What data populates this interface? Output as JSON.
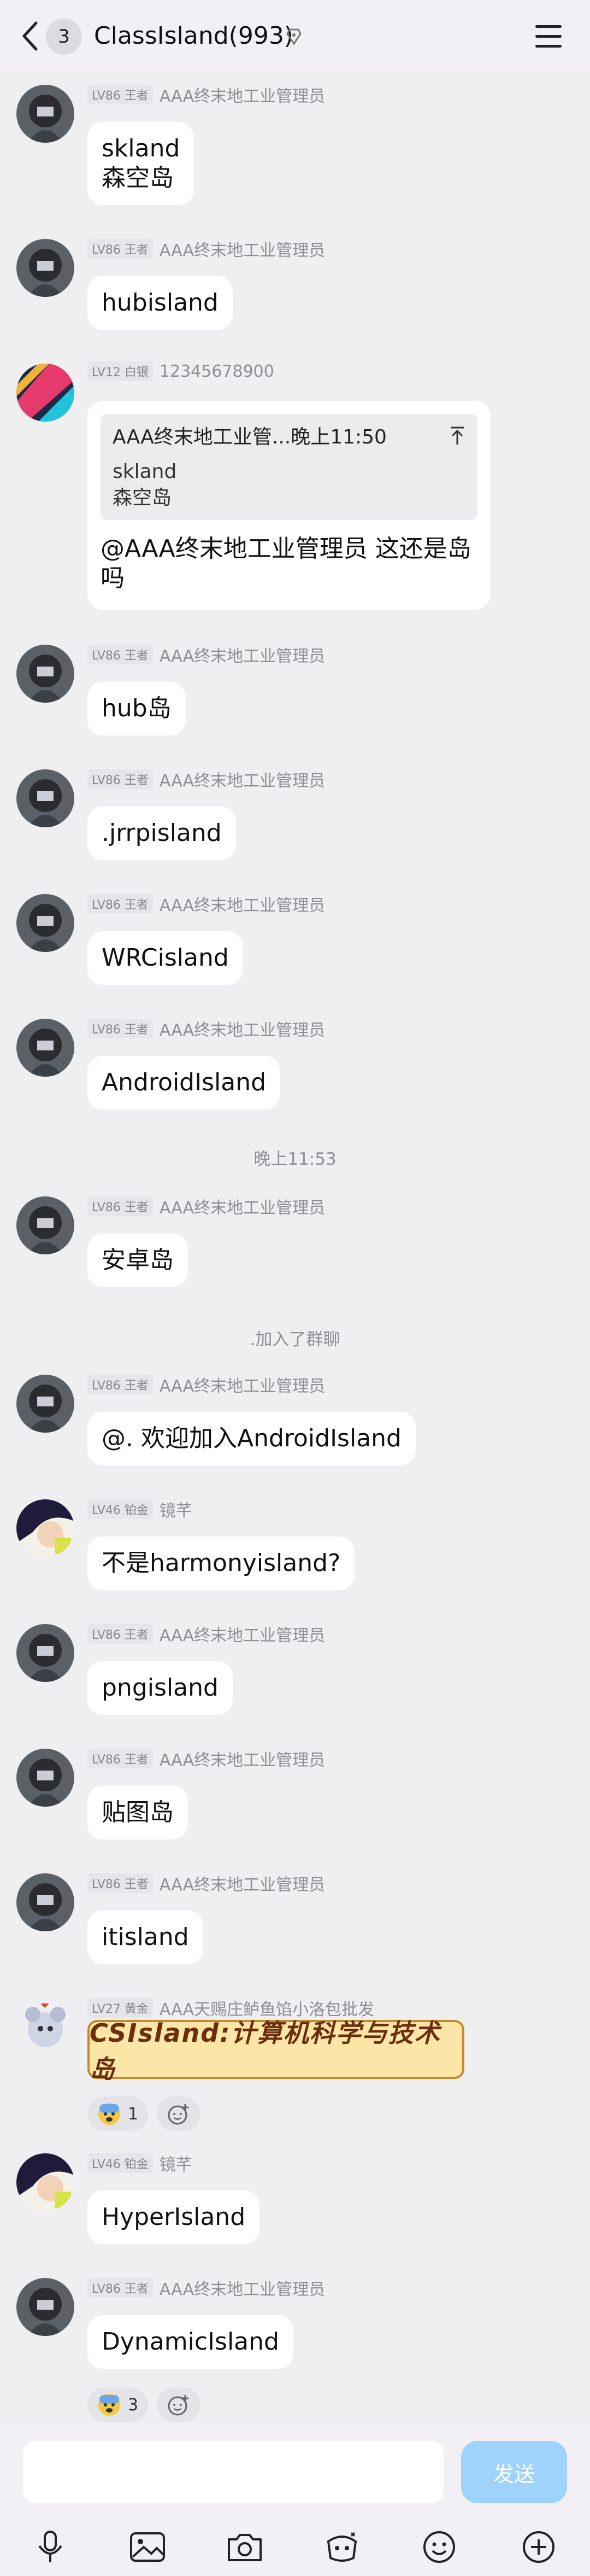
{
  "header": {
    "badge_count": "3",
    "title": "ClassIsland(993)"
  },
  "messages": [
    {
      "level": "LV86 王者",
      "name": "AAA终末地工业管理员",
      "text_lines": [
        "skland",
        "森空岛"
      ]
    },
    {
      "level": "LV86 王者",
      "name": "AAA终末地工业管理员",
      "text": "hubisland"
    },
    {
      "level": "LV12 白银",
      "name": "12345678900",
      "quote": {
        "author": "AAA终末地工业管...",
        "time": "晚上11:50",
        "lines": [
          "skland",
          "森空岛"
        ]
      },
      "text_lines": [
        "@AAA终末地工业管理员 这还是岛",
        "吗"
      ]
    },
    {
      "level": "LV86 王者",
      "name": "AAA终末地工业管理员",
      "text": "hub岛"
    },
    {
      "level": "LV86 王者",
      "name": "AAA终末地工业管理员",
      "text": ".jrrpisland"
    },
    {
      "level": "LV86 王者",
      "name": "AAA终末地工业管理员",
      "text": "WRCisland"
    },
    {
      "level": "LV86 王者",
      "name": "AAA终末地工业管理员",
      "text": "AndroidIsland"
    },
    {
      "level": "LV86 王者",
      "name": "AAA终末地工业管理员",
      "text": "安卓岛"
    },
    {
      "level": "LV86 王者",
      "name": "AAA终末地工业管理员",
      "text": "@. 欢迎加入AndroidIsland"
    },
    {
      "level": "LV46 铂金",
      "name": "镜芊",
      "text": "不是harmonyisland?"
    },
    {
      "level": "LV86 王者",
      "name": "AAA终末地工业管理员",
      "text": "pngisland"
    },
    {
      "level": "LV86 王者",
      "name": "AAA终末地工业管理员",
      "text": "贴图岛"
    },
    {
      "level": "LV86 王者",
      "name": "AAA终末地工业管理员",
      "text": "itisland"
    },
    {
      "level": "LV27 黄金",
      "name": "AAA天赐庄鲈鱼馅小洛包批发",
      "sticker_text": "CSIsland:计算机科学与技术岛",
      "reaction_count": "1"
    },
    {
      "level": "LV46 铂金",
      "name": "镜芊",
      "text": "HyperIsland"
    },
    {
      "level": "LV86 王者",
      "name": "AAA终末地工业管理员",
      "text": "DynamicIsland",
      "reaction_count": "3"
    }
  ],
  "system": {
    "time": "晚上11:53",
    "joined": ".加入了群聊"
  },
  "footer": {
    "send_label": "发送",
    "input_placeholder": ""
  },
  "colors": {
    "accent": "#9fd3fb",
    "background": "#efeff1",
    "bubble": "#ffffff"
  },
  "icons": [
    "back-icon",
    "info-icon",
    "menu-icon",
    "mic-icon",
    "image-icon",
    "camera-icon",
    "red-packet-icon",
    "emoji-icon",
    "plus-icon",
    "scared-emoji-icon",
    "add-reaction-icon"
  ]
}
